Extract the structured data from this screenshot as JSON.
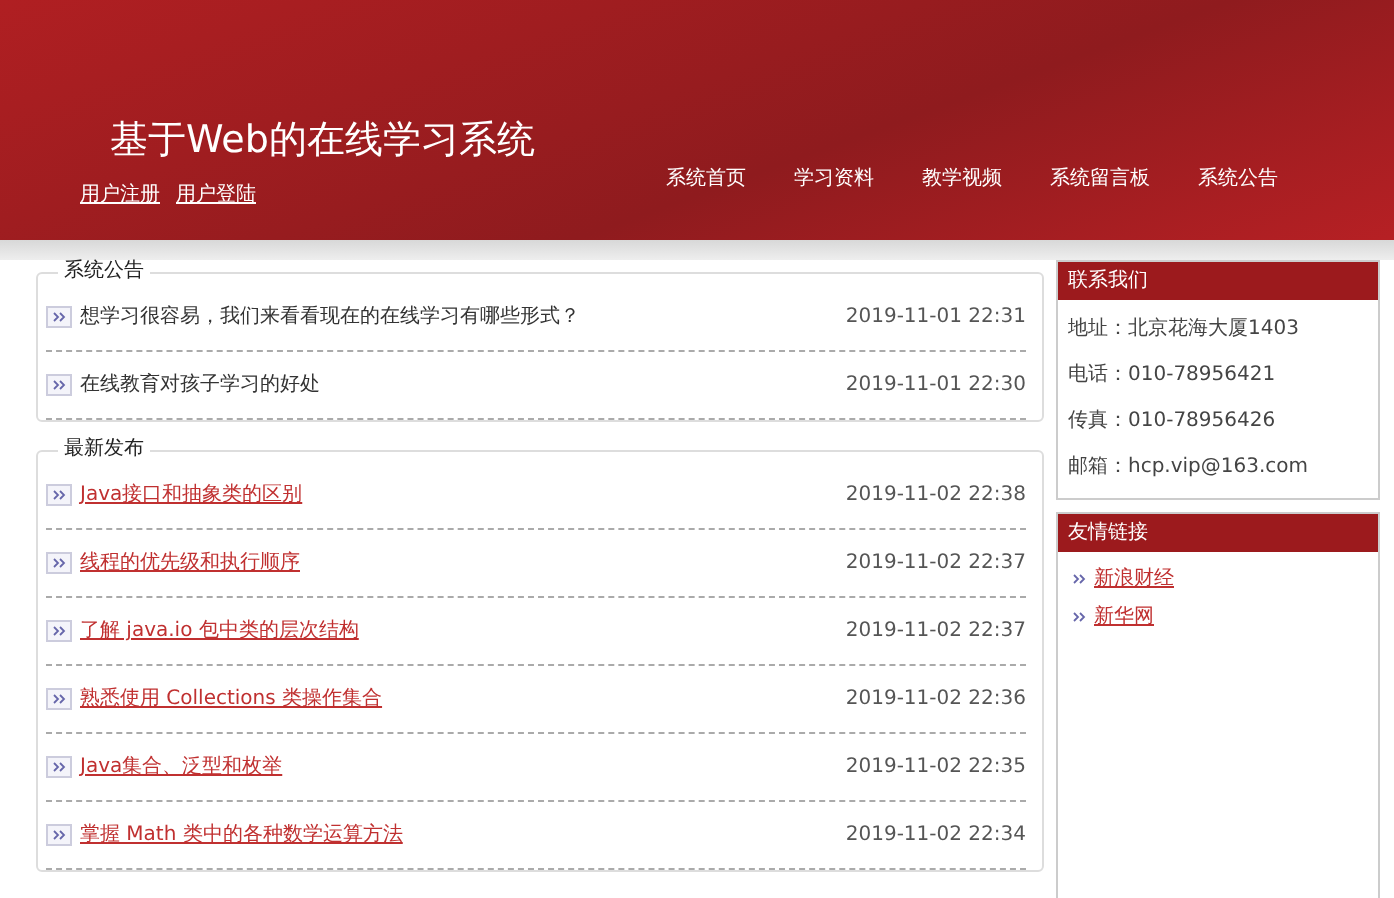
{
  "header": {
    "title": "基于Web的在线学习系统",
    "user_links": [
      "用户注册",
      "用户登陆"
    ],
    "nav": [
      "系统首页",
      "学习资料",
      "教学视频",
      "系统留言板",
      "系统公告"
    ]
  },
  "notices": {
    "heading": "系统公告",
    "items": [
      {
        "title": "想学习很容易，我们来看看现在的在线学习有哪些形式？",
        "time": "2019-11-01 22:31"
      },
      {
        "title": "在线教育对孩子学习的好处",
        "time": "2019-11-01 22:30"
      }
    ]
  },
  "latest": {
    "heading": "最新发布",
    "items": [
      {
        "title": "Java接口和抽象类的区别",
        "time": "2019-11-02 22:38"
      },
      {
        "title": "线程的优先级和执行顺序",
        "time": "2019-11-02 22:37"
      },
      {
        "title": "了解 java.io 包中类的层次结构",
        "time": "2019-11-02 22:37"
      },
      {
        "title": "熟悉使用 Collections 类操作集合",
        "time": "2019-11-02 22:36"
      },
      {
        "title": "Java集合、泛型和枚举",
        "time": "2019-11-02 22:35"
      },
      {
        "title": "掌握 Math 类中的各种数学运算方法",
        "time": "2019-11-02 22:34"
      }
    ]
  },
  "contact": {
    "heading": "联系我们",
    "lines": [
      "地址：北京花海大厦1403",
      "电话：010-78956421",
      "传真：010-78956426",
      "邮箱：hcp.vip@163.com"
    ]
  },
  "friend_links": {
    "heading": "友情链接",
    "links": [
      "新浪财经",
      "新华网"
    ]
  }
}
